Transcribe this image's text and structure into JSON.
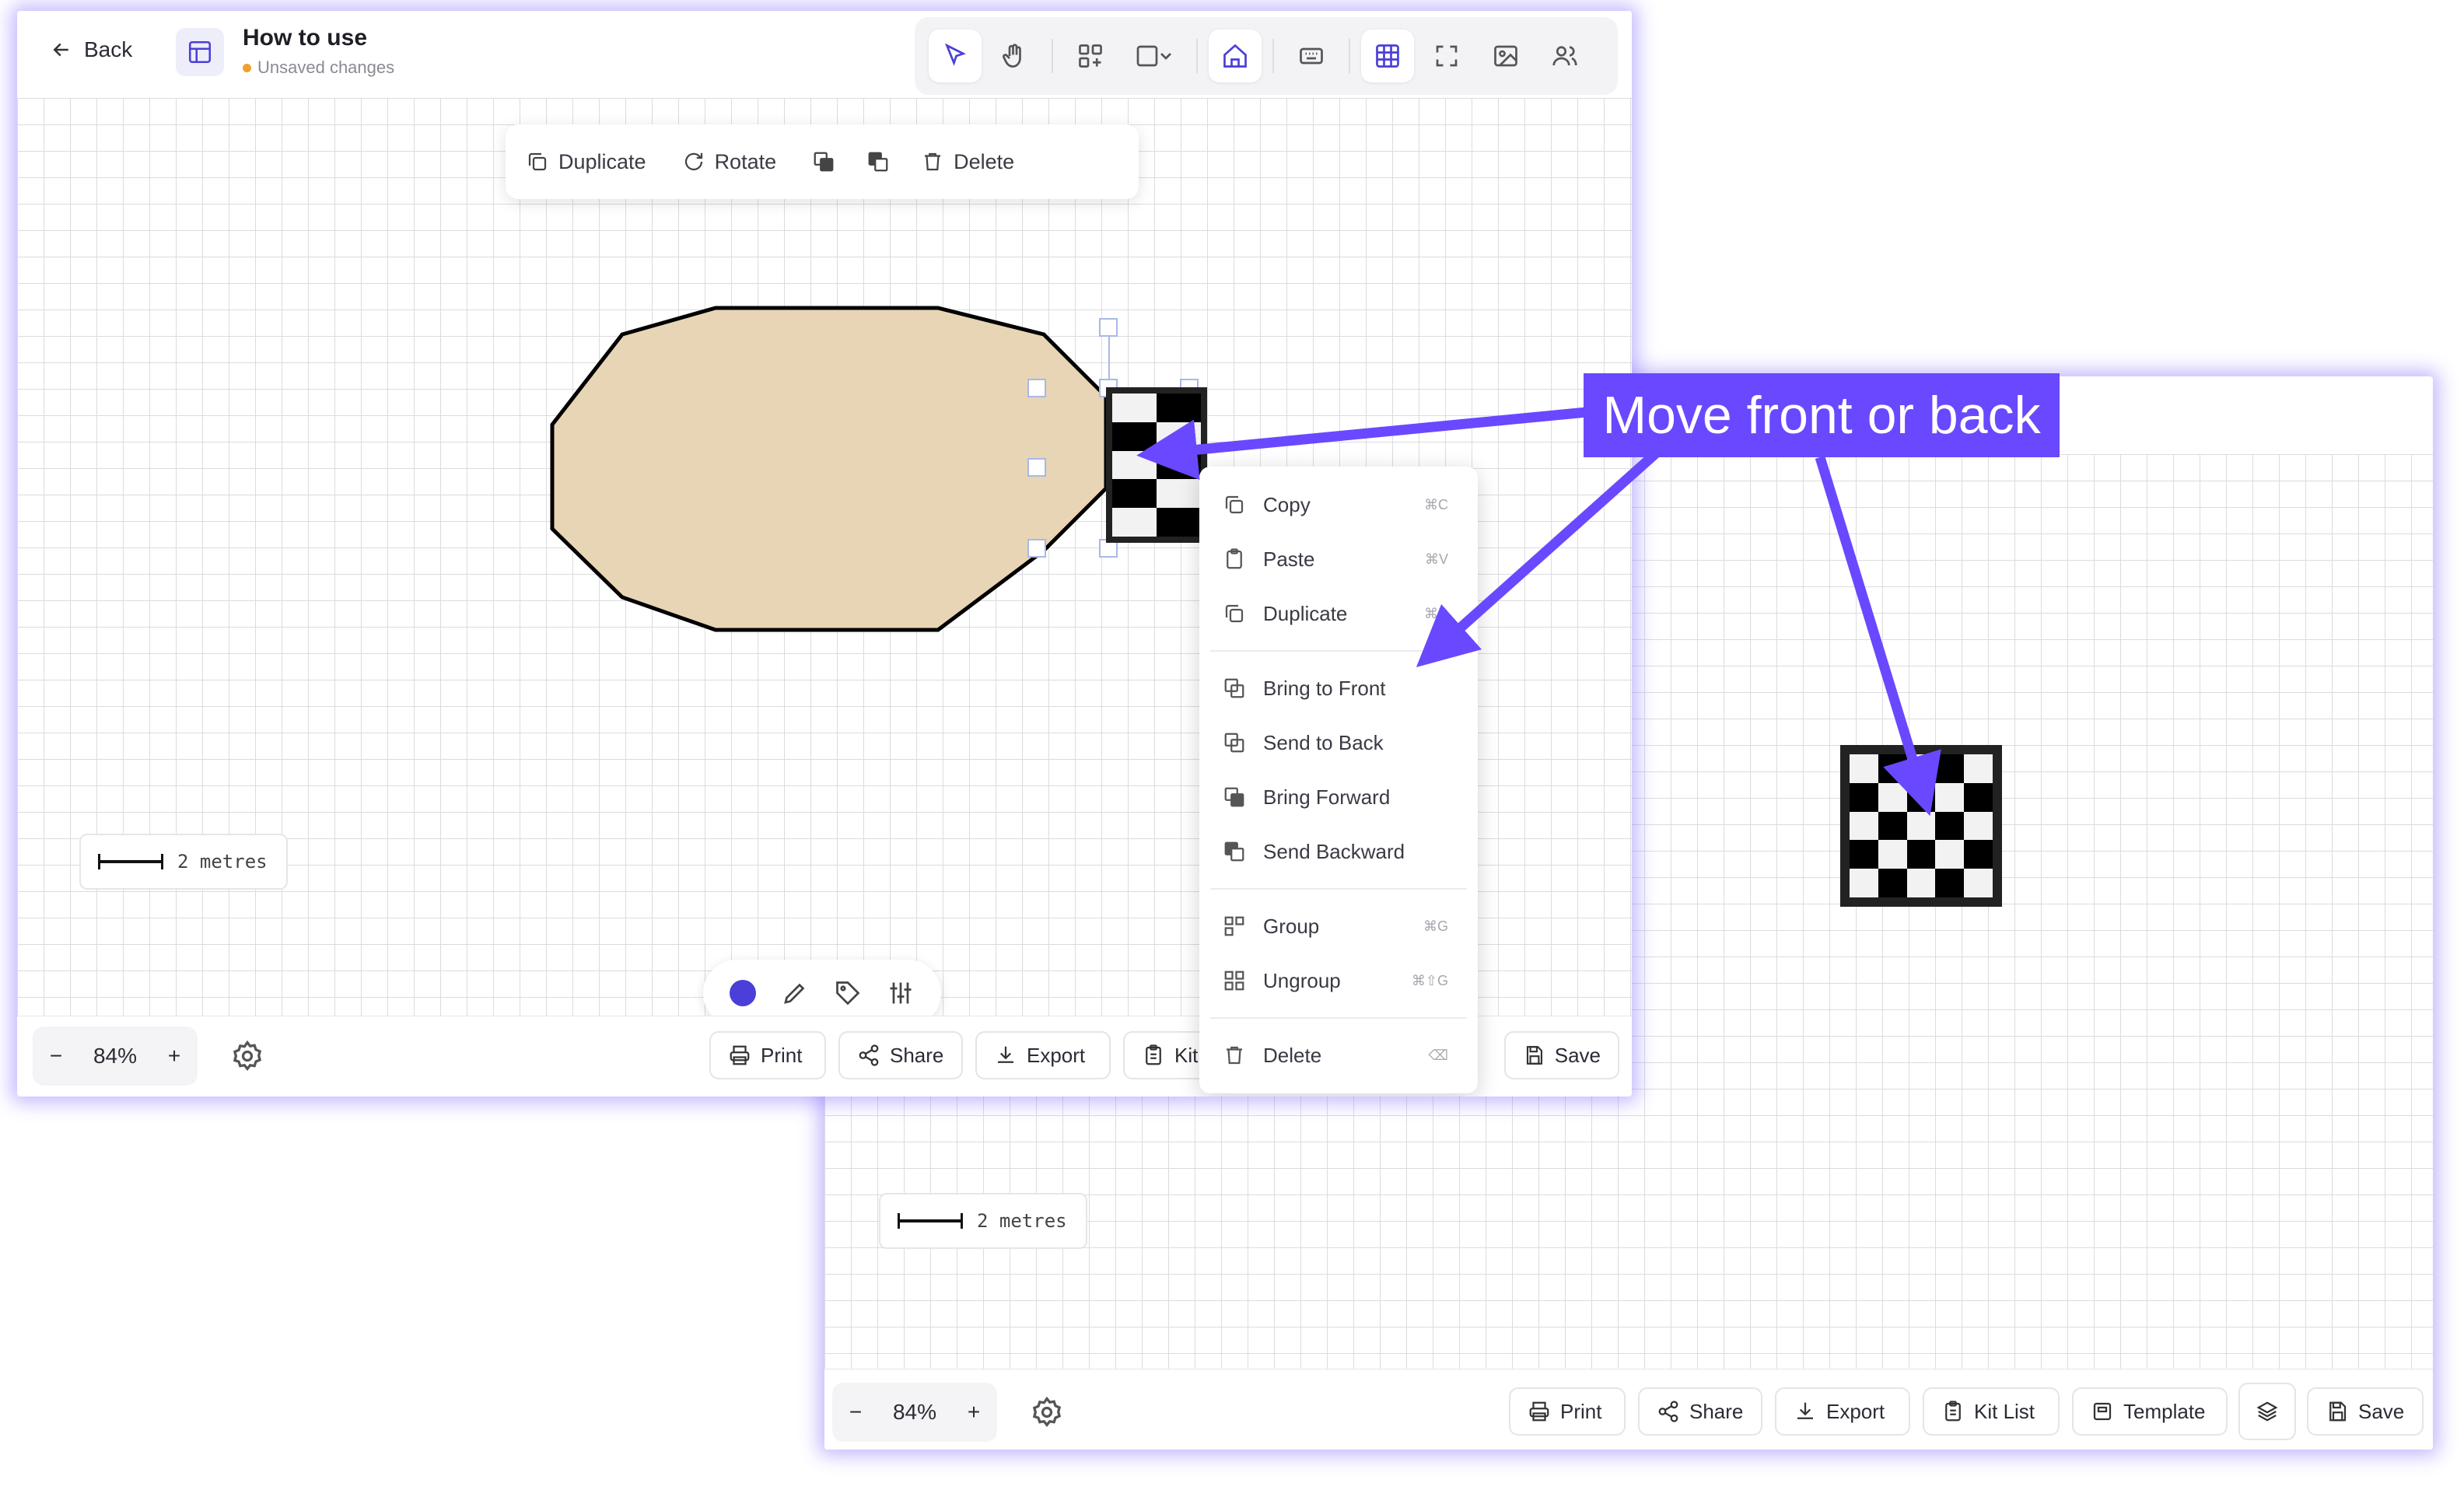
{
  "window1": {
    "back_label": "Back",
    "doc_title": "How to use",
    "status_text": "Unsaved changes",
    "status_color": "#f0a030",
    "floating_toolbar": {
      "duplicate": "Duplicate",
      "rotate": "Rotate",
      "delete": "Delete"
    },
    "scale_text": "2 metres",
    "zoom": {
      "minus": "−",
      "value": "84%",
      "plus": "+"
    },
    "bottom_buttons": {
      "print": "Print",
      "share": "Share",
      "export": "Export",
      "kit": "Kit",
      "save": "Save"
    },
    "context_menu": {
      "items": [
        {
          "label": "Copy",
          "shortcut": "⌘C"
        },
        {
          "label": "Paste",
          "shortcut": "⌘V"
        },
        {
          "label": "Duplicate",
          "shortcut": "⌘D"
        },
        {
          "label": "Bring to Front",
          "shortcut": ""
        },
        {
          "label": "Send to Back",
          "shortcut": ""
        },
        {
          "label": "Bring Forward",
          "shortcut": ""
        },
        {
          "label": "Send Backward",
          "shortcut": ""
        },
        {
          "label": "Group",
          "shortcut": "⌘G"
        },
        {
          "label": "Ungroup",
          "shortcut": "⌘⇧G"
        },
        {
          "label": "Delete",
          "shortcut": "⌫"
        }
      ]
    }
  },
  "window2": {
    "scale_text": "2 metres",
    "zoom": {
      "minus": "−",
      "value": "84%",
      "plus": "+"
    },
    "bottom_buttons": {
      "print": "Print",
      "share": "Share",
      "export": "Export",
      "kit_list": "Kit List",
      "template": "Template",
      "save": "Save"
    }
  },
  "annotation": {
    "text": "Move front or back",
    "color": "#6a48ff"
  },
  "colors": {
    "accent": "#4a3fd8",
    "shape_fill": "#e8d5b5",
    "color_dot": "#4a3fd8"
  },
  "icons": [
    "back-arrow-icon",
    "layout-icon",
    "pointer-icon",
    "hand-icon",
    "add-shape-icon",
    "rectangle-icon",
    "home-icon",
    "keyboard-icon",
    "grid-icon",
    "fullscreen-icon",
    "image-icon",
    "users-icon",
    "layers-icon",
    "settings-icon",
    "printer-icon",
    "share-icon",
    "download-icon",
    "clipboard-icon",
    "save-icon"
  ]
}
